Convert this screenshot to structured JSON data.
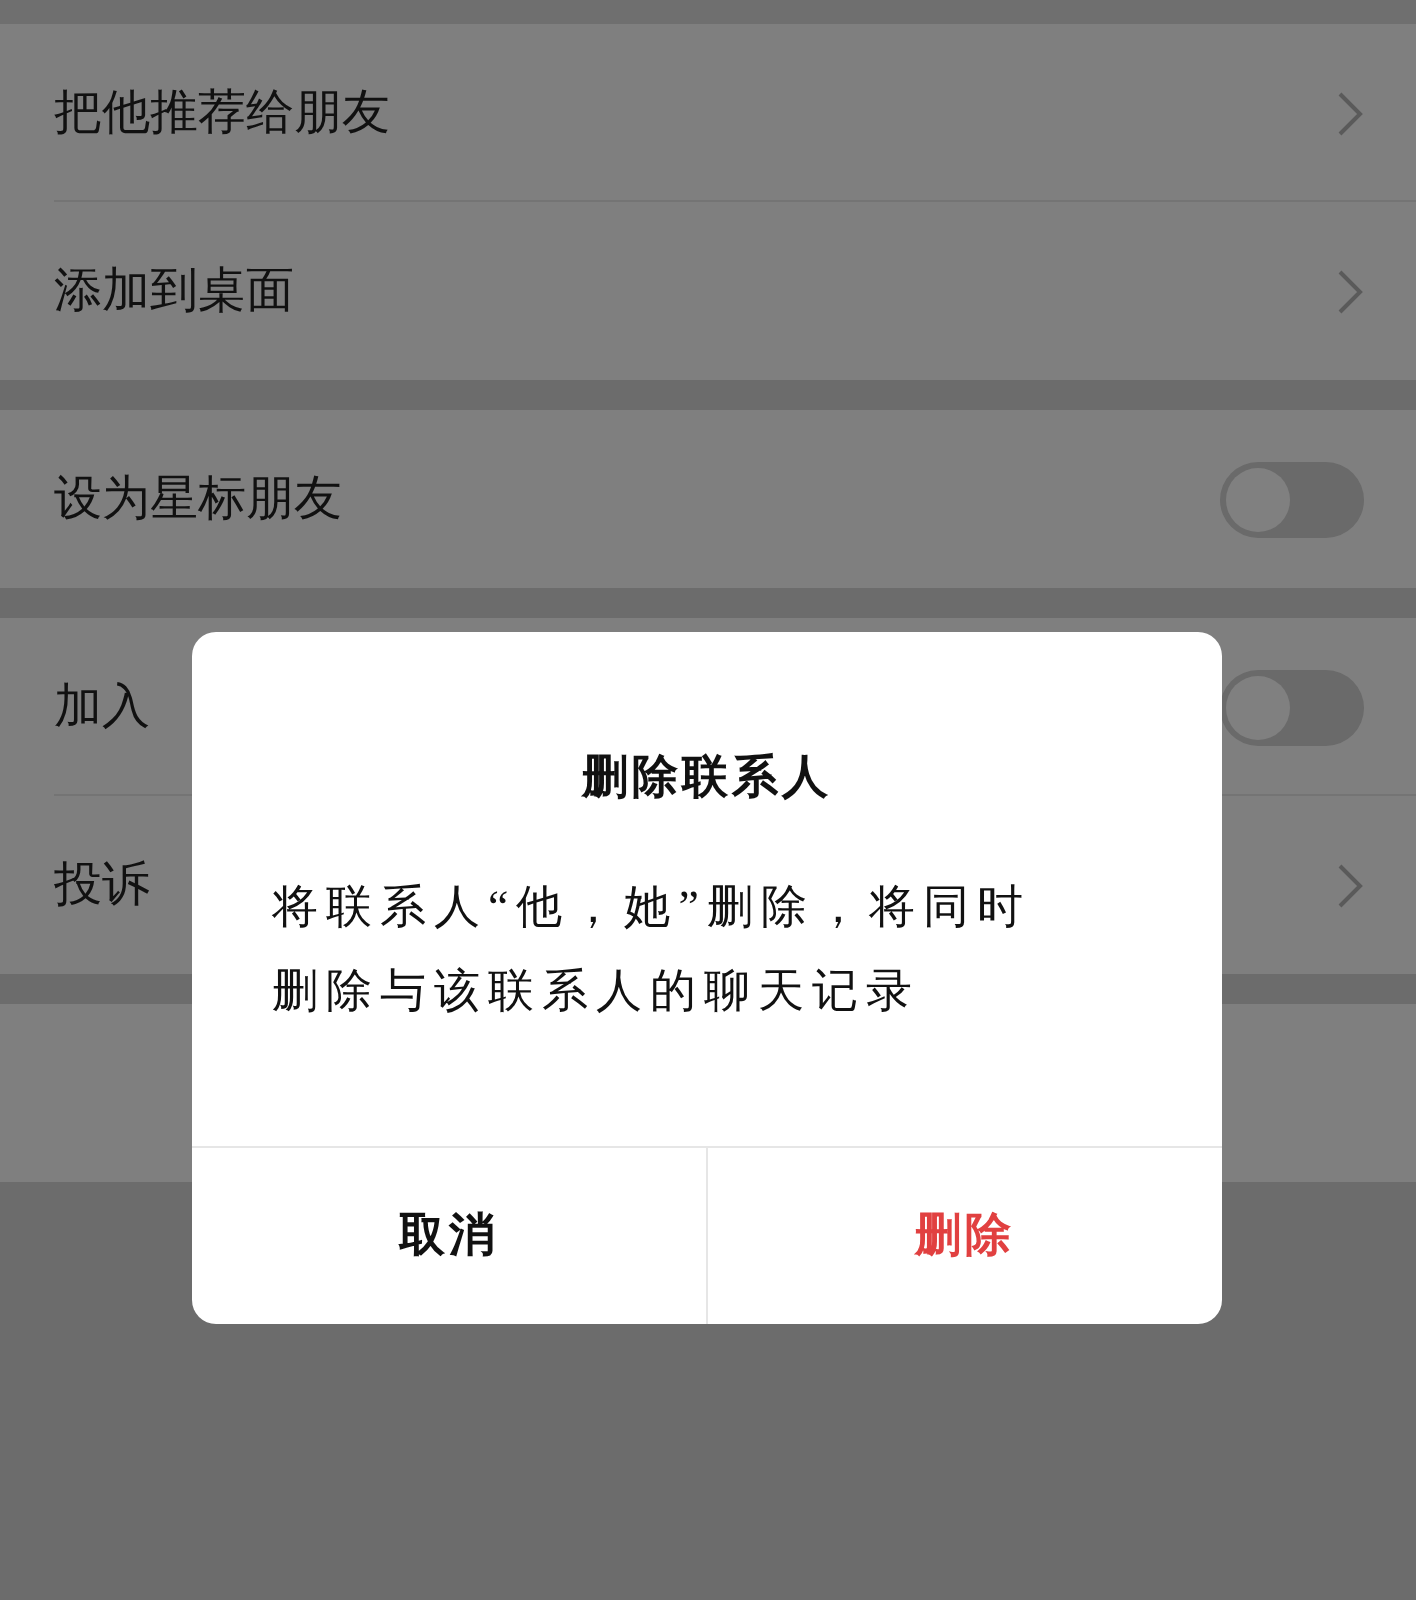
{
  "sections": [
    {
      "rows": [
        {
          "label": "把他推荐给朋友",
          "kind": "link"
        },
        {
          "label": "添加到桌面",
          "kind": "link"
        }
      ]
    },
    {
      "rows": [
        {
          "label": "设为星标朋友",
          "kind": "toggle",
          "on": false
        }
      ]
    },
    {
      "rows": [
        {
          "label": "加入",
          "kind": "toggle",
          "on": false
        },
        {
          "label": "投诉",
          "kind": "link"
        }
      ]
    },
    {
      "rows": [
        {
          "kind": "blank"
        }
      ]
    }
  ],
  "dialog": {
    "title": "删除联系人",
    "message": "将联系人“他，她”删除，将同时删除与该联系人的聊天记录",
    "buttons": [
      {
        "label": "取消",
        "kind": "cancel"
      },
      {
        "label": "删除",
        "kind": "destructive"
      }
    ]
  }
}
